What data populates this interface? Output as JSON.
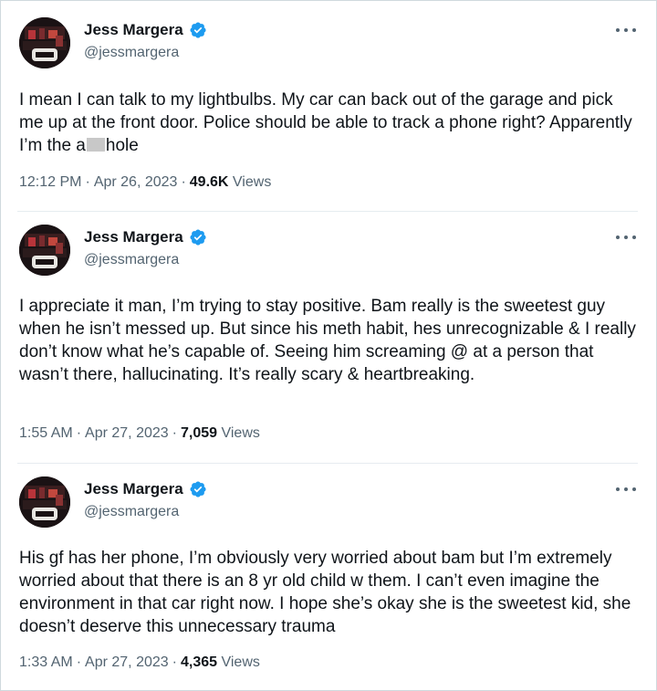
{
  "tweets": [
    {
      "display_name": "Jess Margera",
      "handle": "@jessmargera",
      "text_before": "I mean I can talk to my lightbulbs. My car can back out of the garage and pick me up at the front door. Police should be able to track a phone right? Apparently I’m the a",
      "text_after": "hole",
      "time": "12:12 PM",
      "date": "Apr 26, 2023",
      "views_count": "49.6K",
      "views_label": "Views"
    },
    {
      "display_name": "Jess Margera",
      "handle": "@jessmargera",
      "text": "I appreciate it man, I’m trying to stay positive. Bam really is the sweetest guy when he isn’t messed up. But since his meth habit, hes unrecognizable & I really don’t know what he’s capable of. Seeing him screaming @ at a person that wasn’t there, hallucinating. It’s really scary & heartbreaking.",
      "time": "1:55 AM",
      "date": "Apr 27, 2023",
      "views_count": "7,059",
      "views_label": "Views"
    },
    {
      "display_name": "Jess Margera",
      "handle": "@jessmargera",
      "text": "His gf has her phone, I’m obviously very worried about bam but I’m extremely worried about that there is an 8 yr old child w them. I can’t even imagine the environment in that car right now. I hope she’s okay she is the sweetest kid, she doesn’t deserve this unnecessary trauma",
      "time": "1:33 AM",
      "date": "Apr 27, 2023",
      "views_count": "4,365",
      "views_label": "Views"
    }
  ],
  "meta_separator": "·",
  "colors": {
    "text_primary": "#0f1419",
    "text_secondary": "#536471",
    "verified_blue": "#1d9bf0",
    "divider": "#e6ecf0"
  }
}
